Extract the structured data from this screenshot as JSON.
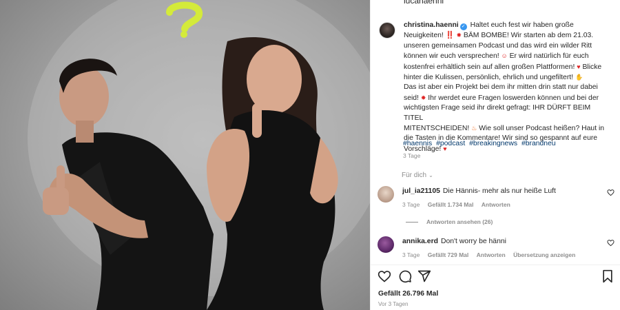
{
  "colors": {
    "accent_link": "#00376b",
    "verified": "#3897f0",
    "muted": "#8e8e8e",
    "question_mark": "#d4ea3a"
  },
  "header": {
    "username": "lucahaenni"
  },
  "post": {
    "author": "christina.haenni",
    "caption_lines": [
      "Haltet euch fest wir haben große",
      "Neuigkeiten! ‼️",
      "BÄM BOMBE! Wir starten ab dem 21.03.",
      "unseren gemeinsamen Podcast und das wird ein wilder Ritt",
      "können wir euch versprechen!",
      "Er wird natürlich für euch",
      "kostenfrei erhältlich sein auf allen großen Plattformen!",
      "Blicke",
      "hinter die Kulissen, persönlich, ehrlich und ungefiltert!",
      "Das ist aber ein Projekt bei dem ihr mitten drin statt nur dabei",
      "seid!",
      "Ihr werdet eure Fragen loswerden können und bei der",
      "wichtigsten Frage seid ihr direkt gefragt: IHR DÜRFT BEIM TITEL",
      "MITENTSCHEIDEN!",
      "Wie soll unser Podcast heißen? Haut in",
      "die Tasten in die Kommentare! Wir sind so gespannt auf eure",
      "Vorschläge!"
    ],
    "hashtags": [
      "#haennis",
      "#podcast",
      "#breakingnews",
      "#brandneu"
    ],
    "time": "3 Tage"
  },
  "for_you": {
    "label": "Für dich"
  },
  "comments": [
    {
      "username": "jul_ia21105",
      "text": "Die Hännis- mehr als nur heiße Luft",
      "time": "3 Tage",
      "likes": "Gefällt 1.734 Mal",
      "reply": "Antworten"
    },
    {
      "username": "annika.erd",
      "text": "Don't worry be hänni",
      "time": "3 Tage",
      "likes": "Gefällt 729 Mal",
      "reply": "Antworten",
      "translate": "Übersetzung anzeigen"
    }
  ],
  "replies": {
    "label": "Antworten ansehen (26)"
  },
  "actions": {
    "icons": [
      "heart-icon",
      "comment-icon",
      "share-icon",
      "bookmark-icon"
    ]
  },
  "footer": {
    "likes": "Gefällt 26.796 Mal",
    "posted": "Vor 3 Tagen"
  }
}
